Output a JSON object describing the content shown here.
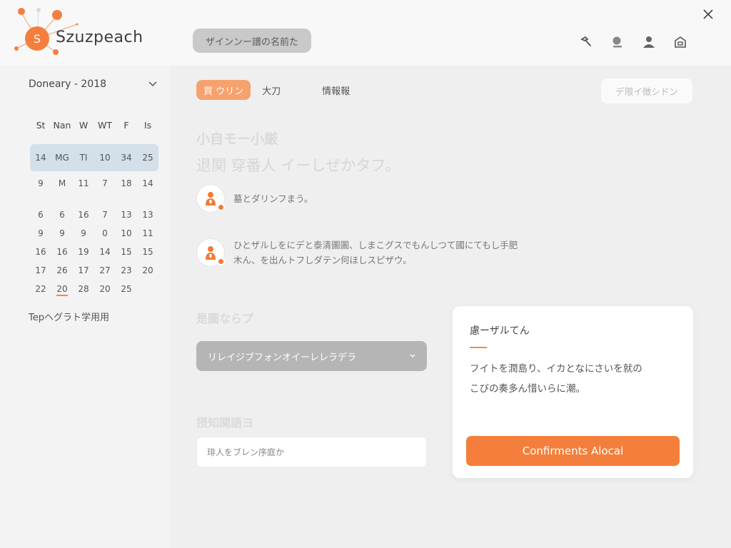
{
  "app": {
    "name": "Szuzpeach"
  },
  "header": {
    "search_label": "ザインンー譜の名前た",
    "icons": [
      "hammer-icon",
      "search-icon",
      "user-icon",
      "home-icon"
    ]
  },
  "sidebar": {
    "month_label": "Doneary - 2018",
    "weekdays": [
      "St",
      "Nan",
      "W",
      "WT",
      "F",
      "Is"
    ],
    "weeks": [
      [
        "14",
        "MG",
        "TI",
        "10",
        "34",
        "25"
      ],
      [
        "9",
        "M",
        "11",
        "7",
        "18",
        "14"
      ],
      [
        "6",
        "6",
        "16",
        "7",
        "13",
        "13"
      ],
      [
        "9",
        "9",
        "9",
        "0",
        "10",
        "11"
      ],
      [
        "16",
        "16",
        "19",
        "14",
        "15",
        "15"
      ],
      [
        "17",
        "26",
        "17",
        "27",
        "23",
        "20"
      ],
      [
        "22",
        "20",
        "28",
        "20",
        "25",
        ""
      ]
    ],
    "footer_link": "Tepヘグラト学用用"
  },
  "main": {
    "tabs": [
      {
        "label": "買 ウリン"
      },
      {
        "label": "大刀"
      },
      {
        "label": "情報報"
      }
    ],
    "action_button": "デ限イ徴シドン",
    "heading": "小自モー小厳",
    "subheading": "退関 穿番人 イーしぜかタフ。",
    "items": [
      {
        "text_lines": [
          "墓とダリンフまう。"
        ]
      },
      {
        "text_lines": [
          "ひとザルしをにデと泰清圖圖、しまこグスでもんしつて國にてもし手肥",
          "木ん、を出んトフしダテン何ほしスピザウ。"
        ]
      }
    ],
    "section1_label": "是圖ならプ",
    "select_value": "リレイジブフォンオイーレレラデラ",
    "section2_label": "摂知関語ヨ",
    "input_placeholder": "琲人をブレン序庭か"
  },
  "card": {
    "title": "慮ーザルてん",
    "body_lines": [
      "フイトを潤島り、イカとなにさいを就の",
      "こびの奏多ん惜いらに潮。"
    ],
    "cta_label": "Confirments Alocal"
  },
  "colors": {
    "accent": "#f47f3c",
    "tab_active": "#f6a26e",
    "highlight_row": "#d3dfe9"
  }
}
